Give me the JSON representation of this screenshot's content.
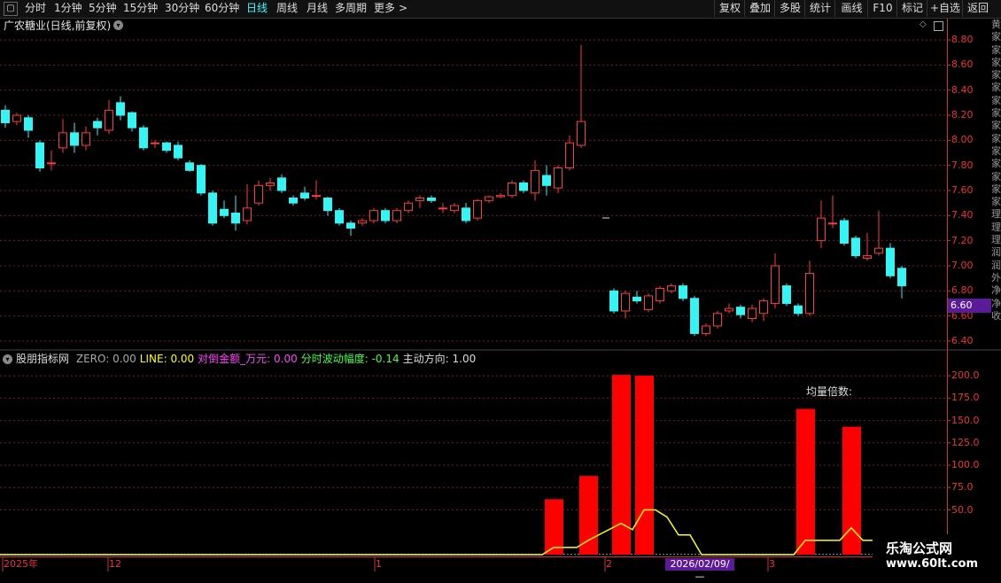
{
  "toolbar": {
    "periods": [
      {
        "label": "分时",
        "active": false
      },
      {
        "label": "1分钟",
        "active": false
      },
      {
        "label": "5分钟",
        "active": false
      },
      {
        "label": "15分钟",
        "active": false
      },
      {
        "label": "30分钟",
        "active": false
      },
      {
        "label": "60分钟",
        "active": false
      },
      {
        "label": "日线",
        "active": true
      },
      {
        "label": "周线",
        "active": false
      },
      {
        "label": "月线",
        "active": false
      },
      {
        "label": "多周期",
        "active": false
      },
      {
        "label": "更多",
        "active": false
      }
    ],
    "right_buttons": [
      "复权",
      "叠加",
      "多股",
      "统计",
      "画线",
      "F10",
      "标记",
      "+自选",
      "返回"
    ]
  },
  "stock": {
    "title": "广农糖业(日线,前复权)"
  },
  "price_axis": {
    "ticks": [
      "8.80",
      "8.60",
      "8.40",
      "8.20",
      "8.00",
      "7.80",
      "7.60",
      "7.40",
      "7.20",
      "7.00",
      "6.80",
      "6.60",
      "6.40"
    ],
    "current_price_tag": "6.60"
  },
  "indicator": {
    "name": "股朋指标网",
    "values": [
      {
        "label": "ZERO: 0.00",
        "color": "#aaaaaa"
      },
      {
        "label": "LINE: 0.00",
        "color": "#ffff00"
      },
      {
        "label": "对倒金额_万元: 0.00",
        "color": "#ff44ff"
      },
      {
        "label": "分时波动幅度: -0.14",
        "color": "#44ff44"
      },
      {
        "label": "主动方向: 1.00",
        "color": "#dddddd"
      }
    ],
    "annotation": "均量倍数:",
    "axis_ticks": [
      "200.0",
      "175.0",
      "150.0",
      "125.0",
      "100.0",
      "75.0",
      "50.0"
    ]
  },
  "date_axis": {
    "labels": [
      "2025年",
      "12",
      "1",
      "2",
      "3"
    ],
    "cursor_date": "2026/02/09/—"
  },
  "right_strip": [
    "黄",
    "家",
    "家",
    "家",
    "家",
    "家",
    "家",
    "家",
    "家",
    "家",
    "家",
    "家",
    "家",
    "家",
    "家",
    "理",
    "理",
    "理",
    "润",
    "润",
    "外",
    "净",
    "净",
    "收"
  ],
  "watermark": {
    "title": "乐淘公式网",
    "url": "www.60lt.com"
  },
  "colors": {
    "up": "#ff3c3c",
    "down": "#33f5f5",
    "volume": "#ff0000",
    "line": "#ffff00",
    "grid": "#7a1a1a"
  },
  "chart_data": [
    {
      "type": "candlestick",
      "title": "广农糖业(日线,前复权)",
      "ylim": [
        6.35,
        8.85
      ],
      "yticks": [
        6.4,
        6.6,
        6.8,
        7.0,
        7.2,
        7.4,
        7.6,
        7.8,
        8.0,
        8.2,
        8.4,
        8.6,
        8.8
      ],
      "candles": [
        {
          "o": 8.24,
          "c": 8.14,
          "h": 8.28,
          "l": 8.1
        },
        {
          "o": 8.15,
          "c": 8.2,
          "h": 8.22,
          "l": 8.12
        },
        {
          "o": 8.18,
          "c": 8.08,
          "h": 8.2,
          "l": 8.02
        },
        {
          "o": 7.98,
          "c": 7.78,
          "h": 8.0,
          "l": 7.75
        },
        {
          "o": 7.82,
          "c": 7.82,
          "h": 7.92,
          "l": 7.76
        },
        {
          "o": 7.94,
          "c": 8.06,
          "h": 8.17,
          "l": 7.9
        },
        {
          "o": 8.06,
          "c": 7.96,
          "h": 8.14,
          "l": 7.9
        },
        {
          "o": 7.96,
          "c": 8.06,
          "h": 8.11,
          "l": 7.92
        },
        {
          "o": 8.15,
          "c": 8.1,
          "h": 8.18,
          "l": 8.04
        },
        {
          "o": 8.08,
          "c": 8.24,
          "h": 8.32,
          "l": 8.05
        },
        {
          "o": 8.3,
          "c": 8.2,
          "h": 8.35,
          "l": 8.16
        },
        {
          "o": 8.22,
          "c": 8.1,
          "h": 8.23,
          "l": 8.07
        },
        {
          "o": 8.1,
          "c": 7.94,
          "h": 8.12,
          "l": 7.92
        },
        {
          "o": 7.98,
          "c": 7.98,
          "h": 8.0,
          "l": 7.94
        },
        {
          "o": 7.98,
          "c": 7.92,
          "h": 7.99,
          "l": 7.9
        },
        {
          "o": 7.96,
          "c": 7.86,
          "h": 7.99,
          "l": 7.84
        },
        {
          "o": 7.82,
          "c": 7.76,
          "h": 7.84,
          "l": 7.75
        },
        {
          "o": 7.8,
          "c": 7.58,
          "h": 7.81,
          "l": 7.56
        },
        {
          "o": 7.58,
          "c": 7.34,
          "h": 7.6,
          "l": 7.32
        },
        {
          "o": 7.45,
          "c": 7.4,
          "h": 7.52,
          "l": 7.38
        },
        {
          "o": 7.42,
          "c": 7.34,
          "h": 7.56,
          "l": 7.28
        },
        {
          "o": 7.36,
          "c": 7.46,
          "h": 7.65,
          "l": 7.33
        },
        {
          "o": 7.5,
          "c": 7.64,
          "h": 7.68,
          "l": 7.48
        },
        {
          "o": 7.64,
          "c": 7.66,
          "h": 7.7,
          "l": 7.6
        },
        {
          "o": 7.7,
          "c": 7.6,
          "h": 7.73,
          "l": 7.58
        },
        {
          "o": 7.54,
          "c": 7.5,
          "h": 7.56,
          "l": 7.48
        },
        {
          "o": 7.58,
          "c": 7.54,
          "h": 7.63,
          "l": 7.52
        },
        {
          "o": 7.56,
          "c": 7.56,
          "h": 7.68,
          "l": 7.53
        },
        {
          "o": 7.54,
          "c": 7.44,
          "h": 7.55,
          "l": 7.4
        },
        {
          "o": 7.44,
          "c": 7.34,
          "h": 7.46,
          "l": 7.32
        },
        {
          "o": 7.34,
          "c": 7.3,
          "h": 7.36,
          "l": 7.24
        },
        {
          "o": 7.34,
          "c": 7.36,
          "h": 7.38,
          "l": 7.32
        },
        {
          "o": 7.36,
          "c": 7.44,
          "h": 7.46,
          "l": 7.34
        },
        {
          "o": 7.44,
          "c": 7.36,
          "h": 7.46,
          "l": 7.34
        },
        {
          "o": 7.36,
          "c": 7.44,
          "h": 7.46,
          "l": 7.34
        },
        {
          "o": 7.44,
          "c": 7.5,
          "h": 7.52,
          "l": 7.42
        },
        {
          "o": 7.52,
          "c": 7.54,
          "h": 7.56,
          "l": 7.46
        },
        {
          "o": 7.54,
          "c": 7.52,
          "h": 7.56,
          "l": 7.5
        },
        {
          "o": 7.46,
          "c": 7.46,
          "h": 7.5,
          "l": 7.42
        },
        {
          "o": 7.44,
          "c": 7.48,
          "h": 7.5,
          "l": 7.42
        },
        {
          "o": 7.46,
          "c": 7.36,
          "h": 7.5,
          "l": 7.34
        },
        {
          "o": 7.38,
          "c": 7.52,
          "h": 7.53,
          "l": 7.36
        },
        {
          "o": 7.52,
          "c": 7.55,
          "h": 7.56,
          "l": 7.5
        },
        {
          "o": 7.55,
          "c": 7.56,
          "h": 7.58,
          "l": 7.54
        },
        {
          "o": 7.56,
          "c": 7.66,
          "h": 7.68,
          "l": 7.54
        },
        {
          "o": 7.66,
          "c": 7.6,
          "h": 7.68,
          "l": 7.58
        },
        {
          "o": 7.58,
          "c": 7.76,
          "h": 7.84,
          "l": 7.52
        },
        {
          "o": 7.72,
          "c": 7.64,
          "h": 7.8,
          "l": 7.56
        },
        {
          "o": 7.62,
          "c": 7.78,
          "h": 7.8,
          "l": 7.58
        },
        {
          "o": 7.78,
          "c": 7.98,
          "h": 8.04,
          "l": 7.76
        },
        {
          "o": 7.96,
          "c": 8.15,
          "h": 8.76,
          "l": 7.94
        },
        {
          "o": 6.8,
          "c": 6.64,
          "h": 6.82,
          "l": 6.62
        },
        {
          "o": 6.64,
          "c": 6.78,
          "h": 6.8,
          "l": 6.58
        },
        {
          "o": 6.75,
          "c": 6.72,
          "h": 6.8,
          "l": 6.7
        },
        {
          "o": 6.65,
          "c": 6.76,
          "h": 6.78,
          "l": 6.63
        },
        {
          "o": 6.72,
          "c": 6.82,
          "h": 6.84,
          "l": 6.7
        },
        {
          "o": 6.8,
          "c": 6.84,
          "h": 6.86,
          "l": 6.78
        },
        {
          "o": 6.84,
          "c": 6.74,
          "h": 6.86,
          "l": 6.72
        },
        {
          "o": 6.74,
          "c": 6.46,
          "h": 6.76,
          "l": 6.44
        },
        {
          "o": 6.46,
          "c": 6.52,
          "h": 6.54,
          "l": 6.44
        },
        {
          "o": 6.52,
          "c": 6.62,
          "h": 6.64,
          "l": 6.5
        },
        {
          "o": 6.64,
          "c": 6.66,
          "h": 6.7,
          "l": 6.62
        },
        {
          "o": 6.67,
          "c": 6.61,
          "h": 6.69,
          "l": 6.58
        },
        {
          "o": 6.58,
          "c": 6.66,
          "h": 6.69,
          "l": 6.55
        },
        {
          "o": 6.62,
          "c": 6.72,
          "h": 6.74,
          "l": 6.56
        },
        {
          "o": 6.7,
          "c": 7.0,
          "h": 7.1,
          "l": 6.66
        },
        {
          "o": 6.84,
          "c": 6.7,
          "h": 6.86,
          "l": 6.68
        },
        {
          "o": 6.68,
          "c": 6.62,
          "h": 6.7,
          "l": 6.6
        },
        {
          "o": 6.62,
          "c": 6.94,
          "h": 7.04,
          "l": 6.6
        },
        {
          "o": 7.2,
          "c": 7.38,
          "h": 7.52,
          "l": 7.14
        },
        {
          "o": 7.34,
          "c": 7.34,
          "h": 7.56,
          "l": 7.3
        },
        {
          "o": 7.36,
          "c": 7.18,
          "h": 7.38,
          "l": 7.16
        },
        {
          "o": 7.22,
          "c": 7.08,
          "h": 7.24,
          "l": 7.06
        },
        {
          "o": 7.06,
          "c": 7.08,
          "h": 7.26,
          "l": 7.04
        },
        {
          "o": 7.1,
          "c": 7.14,
          "h": 7.44,
          "l": 7.08
        },
        {
          "o": 7.14,
          "c": 6.92,
          "h": 7.18,
          "l": 6.9
        },
        {
          "o": 6.98,
          "c": 6.84,
          "h": 7.0,
          "l": 6.74
        }
      ]
    },
    {
      "type": "bar",
      "title": "股朋指标网",
      "ylim": [
        0,
        210
      ],
      "yticks": [
        50,
        75,
        100,
        125,
        150,
        175,
        200
      ],
      "bars": [
        {
          "i": 47,
          "v": 62
        },
        {
          "i": 50,
          "v": 88
        },
        {
          "i": 51,
          "v": 201
        },
        {
          "i": 53,
          "v": 200
        },
        {
          "i": 67,
          "v": 163
        },
        {
          "i": 71,
          "v": 143
        }
      ],
      "line": {
        "name": "均量倍数",
        "values": [
          0,
          0,
          0,
          0,
          0,
          0,
          0,
          0,
          0,
          0,
          0,
          0,
          0,
          0,
          0,
          0,
          0,
          0,
          0,
          0,
          0,
          0,
          0,
          0,
          0,
          0,
          0,
          0,
          0,
          0,
          0,
          0,
          0,
          0,
          0,
          0,
          0,
          0,
          0,
          0,
          0,
          0,
          0,
          0,
          0,
          0,
          0,
          8,
          8,
          8,
          16,
          35,
          28,
          50,
          50,
          42,
          22,
          22,
          0,
          0,
          0,
          0,
          0,
          0,
          0,
          0,
          0,
          16,
          16,
          16,
          16,
          30,
          16,
          16,
          16,
          16,
          0
        ]
      }
    }
  ]
}
